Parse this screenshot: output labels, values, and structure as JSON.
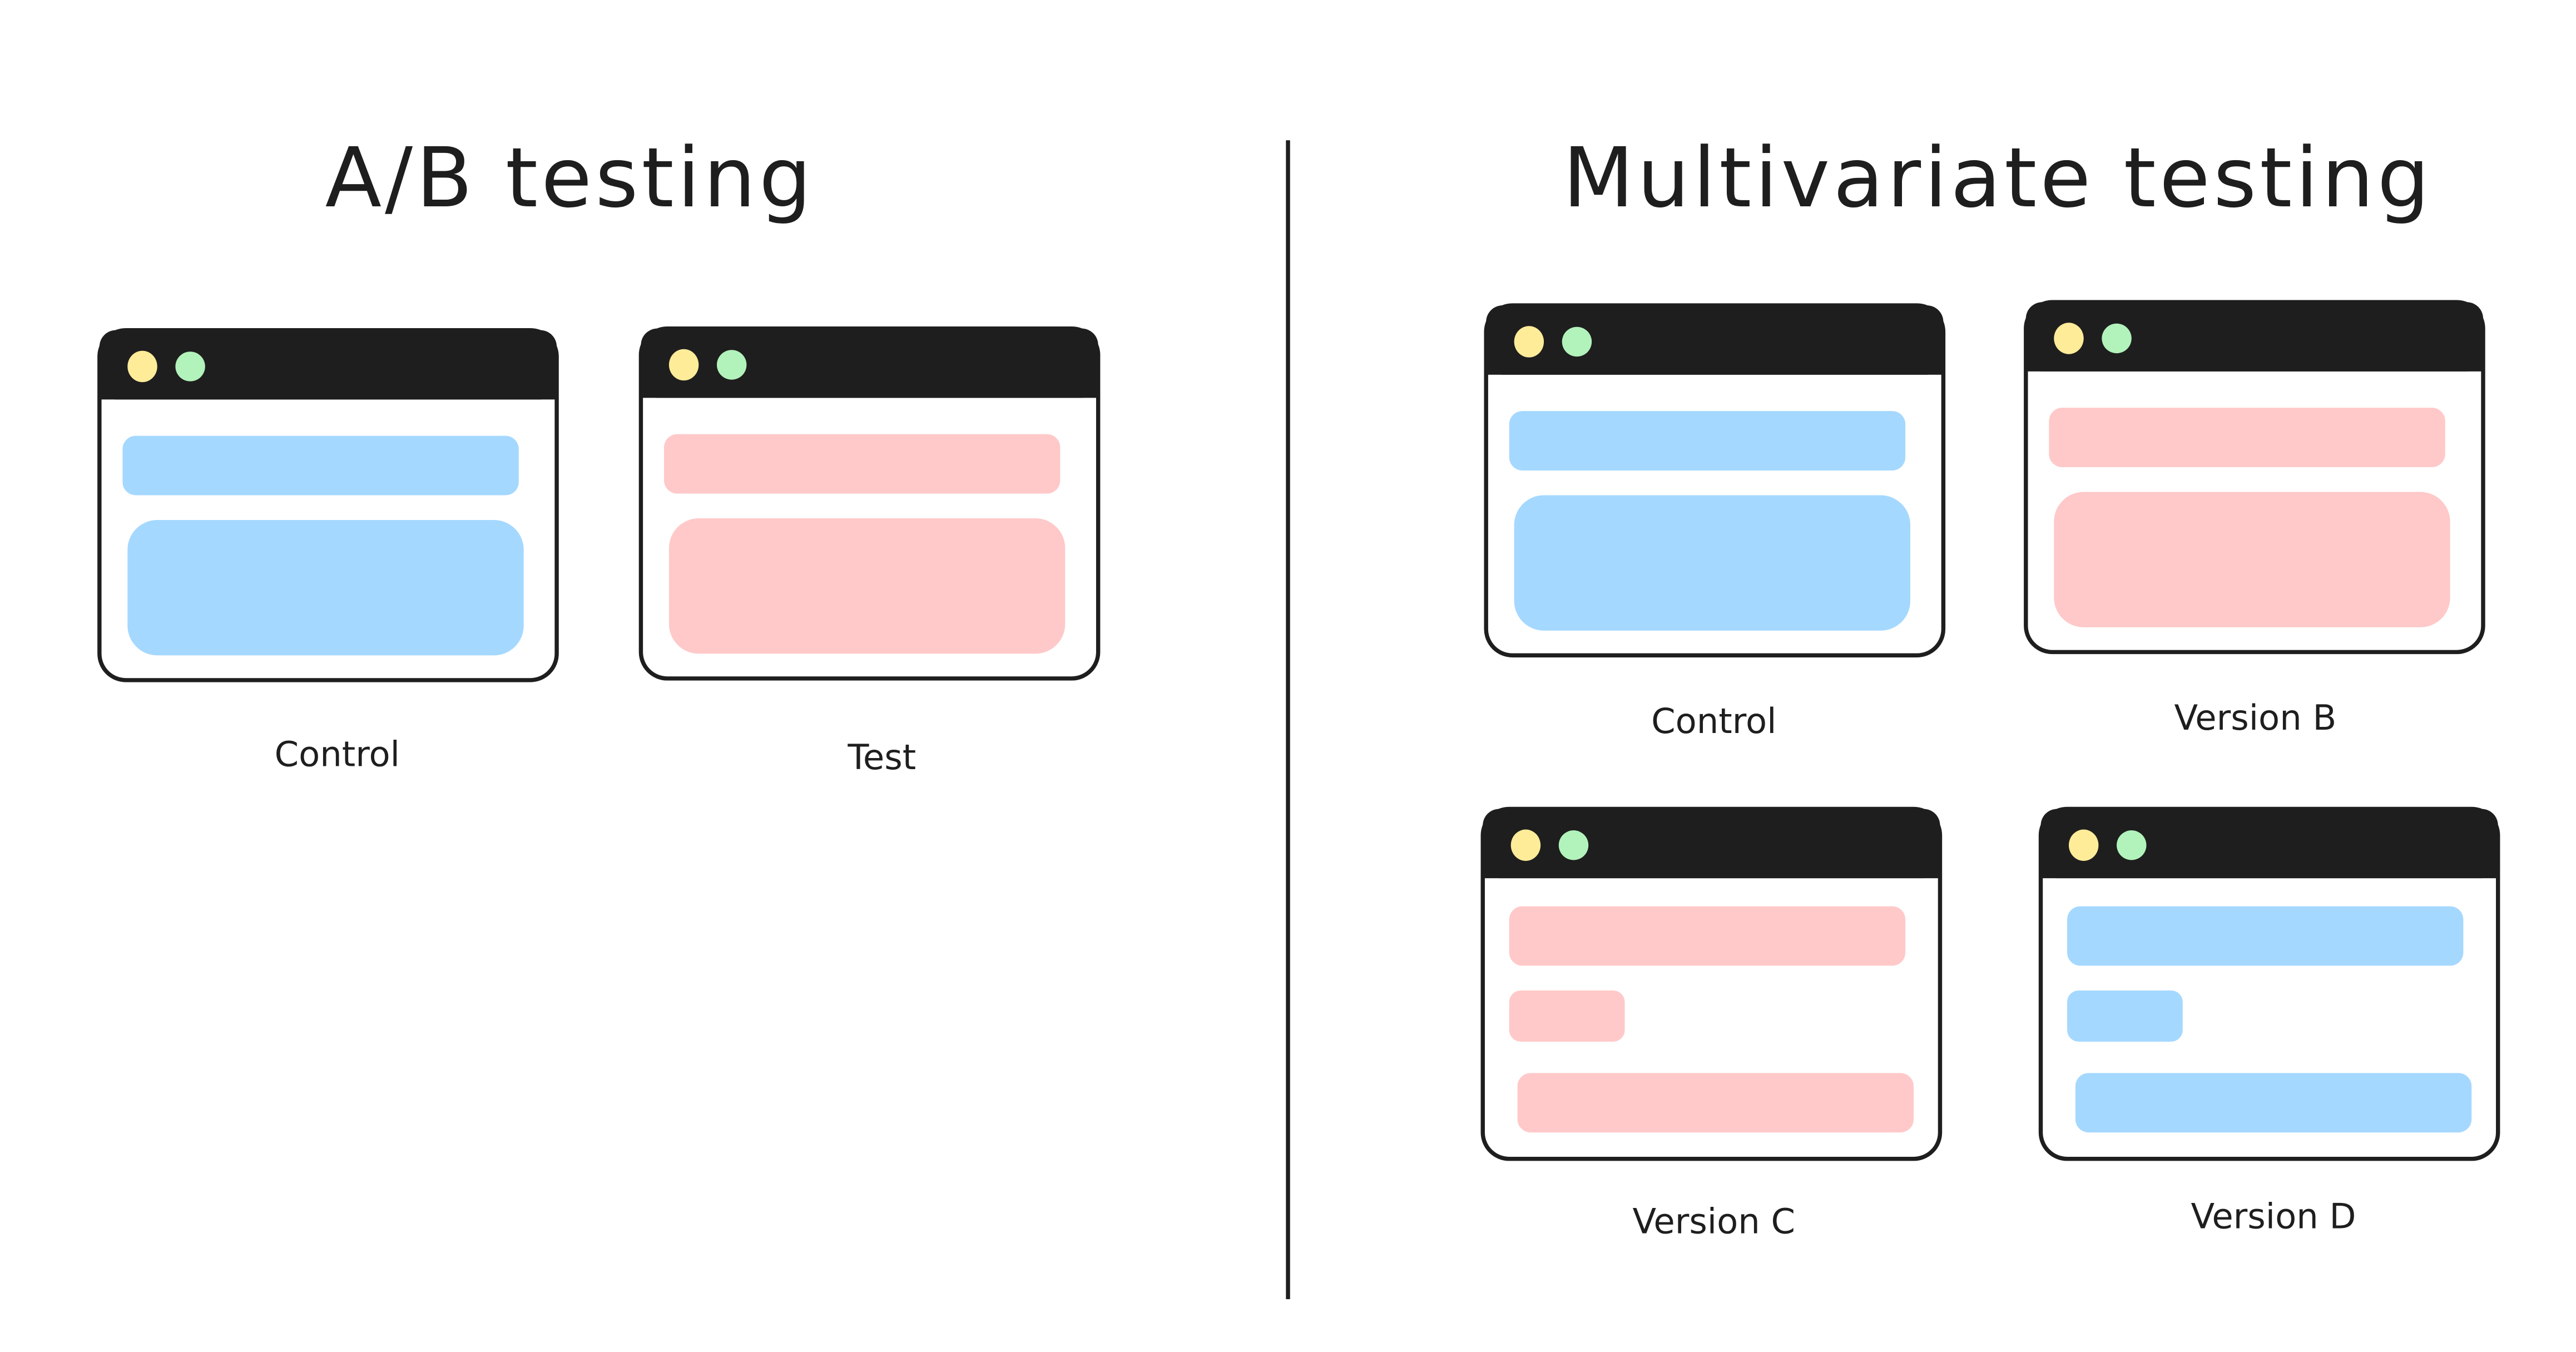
{
  "colors": {
    "ink": "#1e1e1e",
    "dot_yellow": "#ffec99",
    "dot_green": "#b2f2bb",
    "blue": "#a5d8ff",
    "pink": "#ffc9c9"
  },
  "ab": {
    "title": "A/B testing",
    "windows": [
      {
        "label": "Control",
        "variant": "blue",
        "layout": "two-block"
      },
      {
        "label": "Test",
        "variant": "pink",
        "layout": "two-block"
      }
    ]
  },
  "mv": {
    "title": "Multivariate testing",
    "windows": [
      {
        "label": "Control",
        "variant": "blue",
        "layout": "two-block"
      },
      {
        "label": "Version B",
        "variant": "pink",
        "layout": "two-block"
      },
      {
        "label": "Version C",
        "variant": "pink",
        "layout": "three-bar"
      },
      {
        "label": "Version D",
        "variant": "blue",
        "layout": "three-bar"
      }
    ]
  }
}
